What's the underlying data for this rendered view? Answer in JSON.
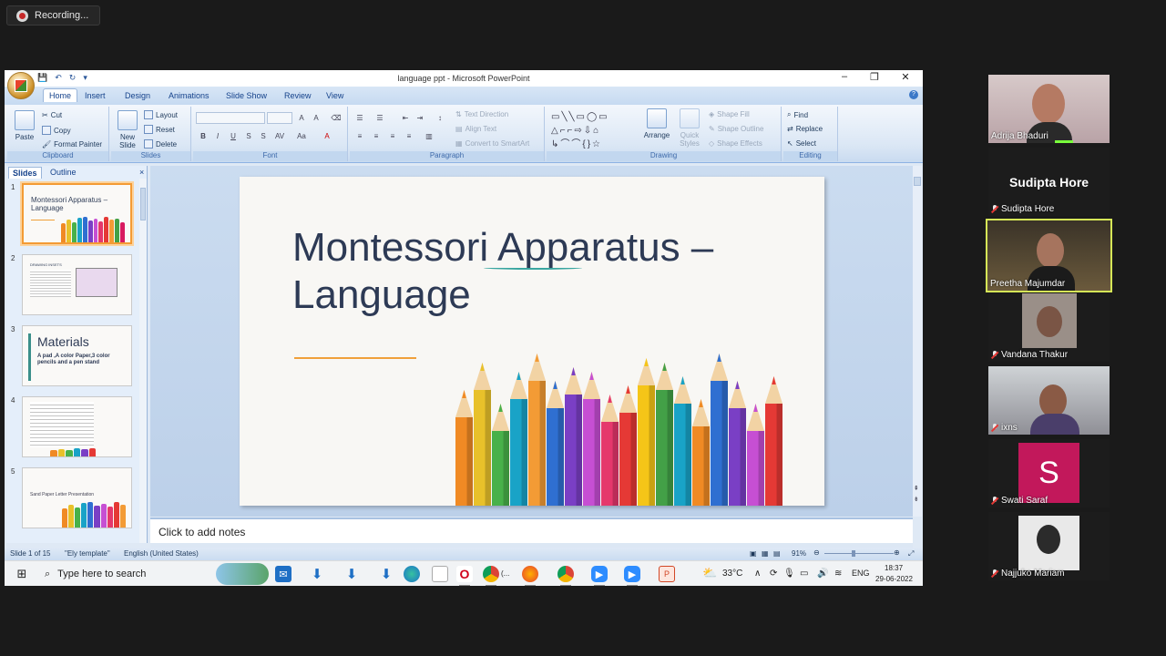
{
  "recording": {
    "label": "Recording..."
  },
  "window": {
    "title": "language ppt - Microsoft PowerPoint"
  },
  "tabs": [
    "Home",
    "Insert",
    "Design",
    "Animations",
    "Slide Show",
    "Review",
    "View"
  ],
  "ribbon": {
    "clipboard": {
      "paste": "Paste",
      "cut": "Cut",
      "copy": "Copy",
      "format_painter": "Format Painter",
      "label": "Clipboard"
    },
    "slides": {
      "new_slide": "New Slide",
      "layout": "Layout",
      "reset": "Reset",
      "delete": "Delete",
      "label": "Slides"
    },
    "font": {
      "label": "Font"
    },
    "paragraph": {
      "text_direction": "Text Direction",
      "align_text": "Align Text",
      "convert_smartart": "Convert to SmartArt",
      "label": "Paragraph"
    },
    "drawing": {
      "arrange": "Arrange",
      "quick_styles": "Quick Styles",
      "shape_fill": "Shape Fill",
      "shape_outline": "Shape Outline",
      "shape_effects": "Shape Effects",
      "label": "Drawing"
    },
    "editing": {
      "find": "Find",
      "replace": "Replace",
      "select": "Select",
      "label": "Editing"
    }
  },
  "pane_tabs": {
    "slides": "Slides",
    "outline": "Outline"
  },
  "thumbnails": [
    {
      "num": "1",
      "title": "Montessori Apparatus – Language"
    },
    {
      "num": "2",
      "title": "DRAWING INSETS"
    },
    {
      "num": "3",
      "title": "Materials",
      "sub": "A pad ,A color Paper,3 color pencils and a pen stand"
    },
    {
      "num": "4",
      "title": ""
    },
    {
      "num": "5",
      "title": "Sand Paper Letter Presentation"
    }
  ],
  "slide": {
    "title_line1": "Montessori Apparatus –",
    "title_line2": "Language"
  },
  "notes": {
    "placeholder": "Click to add notes"
  },
  "status": {
    "slide_of": "Slide 1 of 15",
    "template": "\"Ely template\"",
    "language": "English (United States)",
    "zoom": "91%"
  },
  "taskbar": {
    "search_placeholder": "Type here to search",
    "temperature": "33°C",
    "lang": "ENG",
    "time": "18:37",
    "date": "29-06-2022",
    "chrome_label": "(..."
  },
  "participants": [
    {
      "name": "Adrija Bhaduri",
      "muted": false
    },
    {
      "name": "Sudipta Hore",
      "muted": true,
      "header": "Sudipta Hore"
    },
    {
      "name": "Preetha Majumdar",
      "muted": false,
      "active": true
    },
    {
      "name": "Vandana Thakur",
      "muted": true
    },
    {
      "name": "ixns",
      "muted": true
    },
    {
      "name": "Swati Saraf",
      "muted": true,
      "initial": "S"
    },
    {
      "name": "Najjuko Mariam",
      "muted": true
    }
  ],
  "colors": {
    "ribbon_text": "#1e395b",
    "accent_orange": "#f39b35",
    "slide_title": "#2d3a55",
    "swati_tile": "#c2185b"
  }
}
